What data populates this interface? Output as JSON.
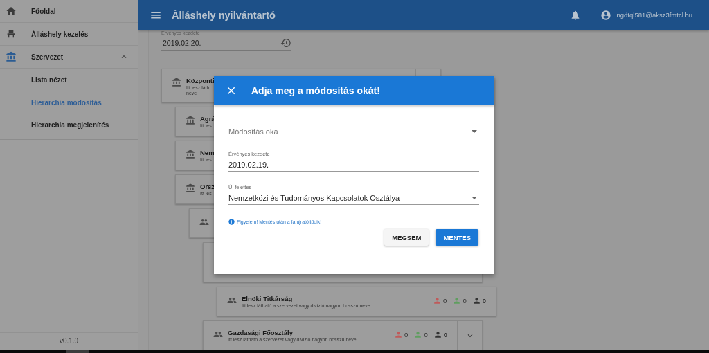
{
  "sidebar": {
    "items": [
      {
        "label": "Főoldal",
        "kind": "home"
      },
      {
        "label": "Álláshely kezelés",
        "kind": "seat"
      },
      {
        "label": "Szervezet",
        "kind": "bank",
        "expanded": true,
        "children": [
          {
            "label": "Lista nézet",
            "selected": false
          },
          {
            "label": "Hierarchia módosítás",
            "selected": true
          },
          {
            "label": "Hierarchia megjelenítés",
            "selected": false
          }
        ]
      }
    ],
    "version": "v0.1.0"
  },
  "header": {
    "title": "Álláshely nyilvántartó",
    "user": "ingdtql581@aksz3fmtcl.hu"
  },
  "date_field": {
    "label": "Érvényes kezdete",
    "value": "2019.02.20."
  },
  "tree": [
    {
      "kind": "unit",
      "title": "Központi",
      "subtitle_lines": [
        "Itt lesz láth",
        "neve"
      ],
      "expandable": true,
      "children": [
        {
          "kind": "unit",
          "title": "Agrá",
          "subtitle_lines": [
            "Itt les"
          ]
        },
        {
          "kind": "unit",
          "title": "Nem",
          "subtitle_lines": [
            "Itt les"
          ]
        },
        {
          "kind": "unit",
          "title": "Orsz",
          "subtitle_lines": [
            "Itt les"
          ],
          "children": [
            {
              "kind": "group",
              "children": [
                {
                  "kind": "hidden",
                  "children": [
                    {
                      "kind": "group",
                      "title": "Elnöki Titkárság",
                      "subtitle_lines": [
                        "Itt lesz látható a szervezet vagy divízió nagyon hosszú neve"
                      ],
                      "counts": [
                        {
                          "value": "0",
                          "color": "#c05a5a"
                        },
                        {
                          "value": "0",
                          "color": "#5f9e5f"
                        },
                        {
                          "value": "0",
                          "color": "#333333"
                        }
                      ]
                    }
                  ]
                },
                {
                  "kind": "group",
                  "title": "Gazdasági Főosztály",
                  "subtitle_lines": [
                    "Itt lesz látható a szervezet vagy divízió nagyon hosszú neve"
                  ],
                  "expandable": true,
                  "counts": [
                    {
                      "value": "0",
                      "color": "#c05a5a"
                    },
                    {
                      "value": "0",
                      "color": "#5f9e5f"
                    },
                    {
                      "value": "0",
                      "color": "#333333"
                    }
                  ]
                }
              ]
            }
          ]
        }
      ]
    }
  ],
  "dialog": {
    "title": "Adja meg a módosítás okát!",
    "fields": [
      {
        "kind": "select",
        "placeholder": "Módosítás oka"
      },
      {
        "kind": "text",
        "label": "Érvényes kezdete",
        "value": "2019.02.19."
      },
      {
        "kind": "select",
        "label": "Új felettes",
        "value": "Nemzetközi és Tudományos Kapcsolatok Osztálya"
      }
    ],
    "notice": "Figyelem! Mentés után a fa újratöltődik!",
    "buttons": [
      {
        "label": "MÉGSEM",
        "kind": "secondary"
      },
      {
        "label": "MENTÉS",
        "kind": "primary"
      }
    ]
  }
}
